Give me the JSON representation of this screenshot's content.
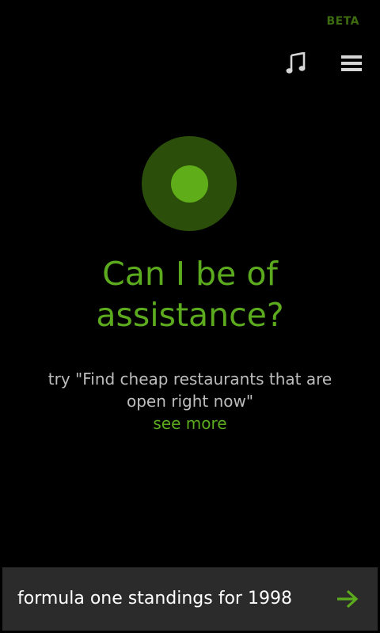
{
  "header": {
    "badge": "BETA",
    "music_icon": "music-note-icon",
    "menu_icon": "hamburger-menu-icon"
  },
  "prompt": {
    "headline": "Can I be of assistance?",
    "hint": "try \"Find cheap restaurants that are open right now\"",
    "see_more": "see more"
  },
  "query": {
    "value": "formula one standings for 1998",
    "submit_icon": "arrow-right-icon"
  },
  "colors": {
    "background": "#000000",
    "accent": "#5cab1e",
    "orb_outer": "#2b4f0a",
    "orb_inner": "#60ad1a",
    "beta": "#3d6c10",
    "query_bar": "#2b2b2b",
    "hint_text": "#bdbdbd"
  }
}
